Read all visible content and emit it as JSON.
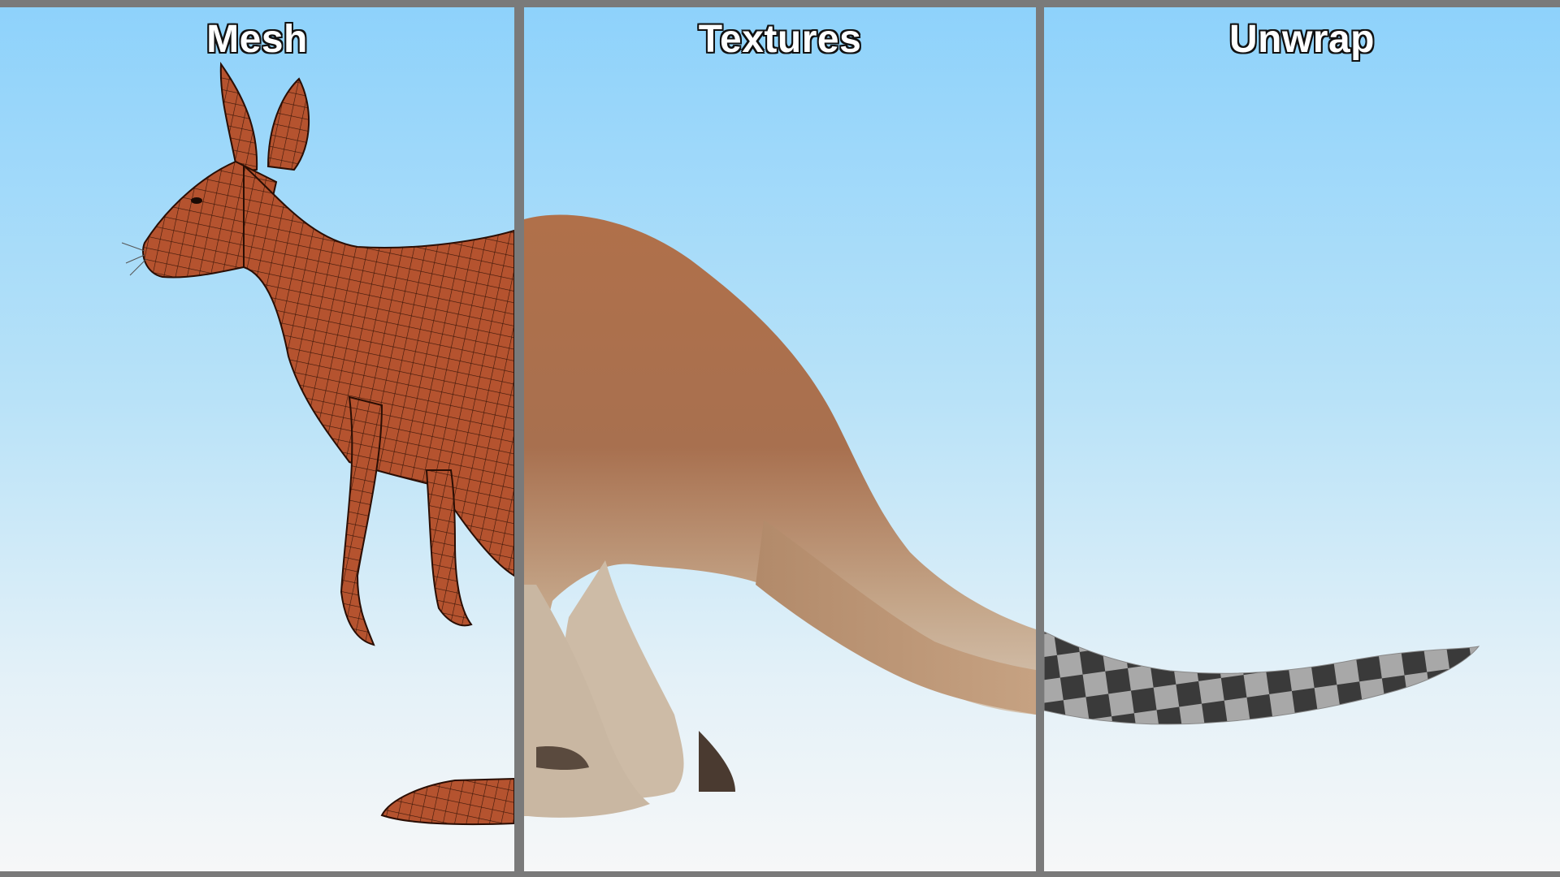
{
  "panels": {
    "mesh": {
      "title": "Mesh"
    },
    "textures": {
      "title": "Textures"
    },
    "unwrap": {
      "title": "Unwrap"
    }
  },
  "colors": {
    "sky_top": "#8ed2fb",
    "ground_bottom": "#f6f7f8",
    "divider": "#7a7a7a",
    "mesh_fill": "#b5532f",
    "fur_fill": "#b0704a",
    "checker_dark": "#3a3a3a",
    "checker_light": "#a8a8a8"
  }
}
